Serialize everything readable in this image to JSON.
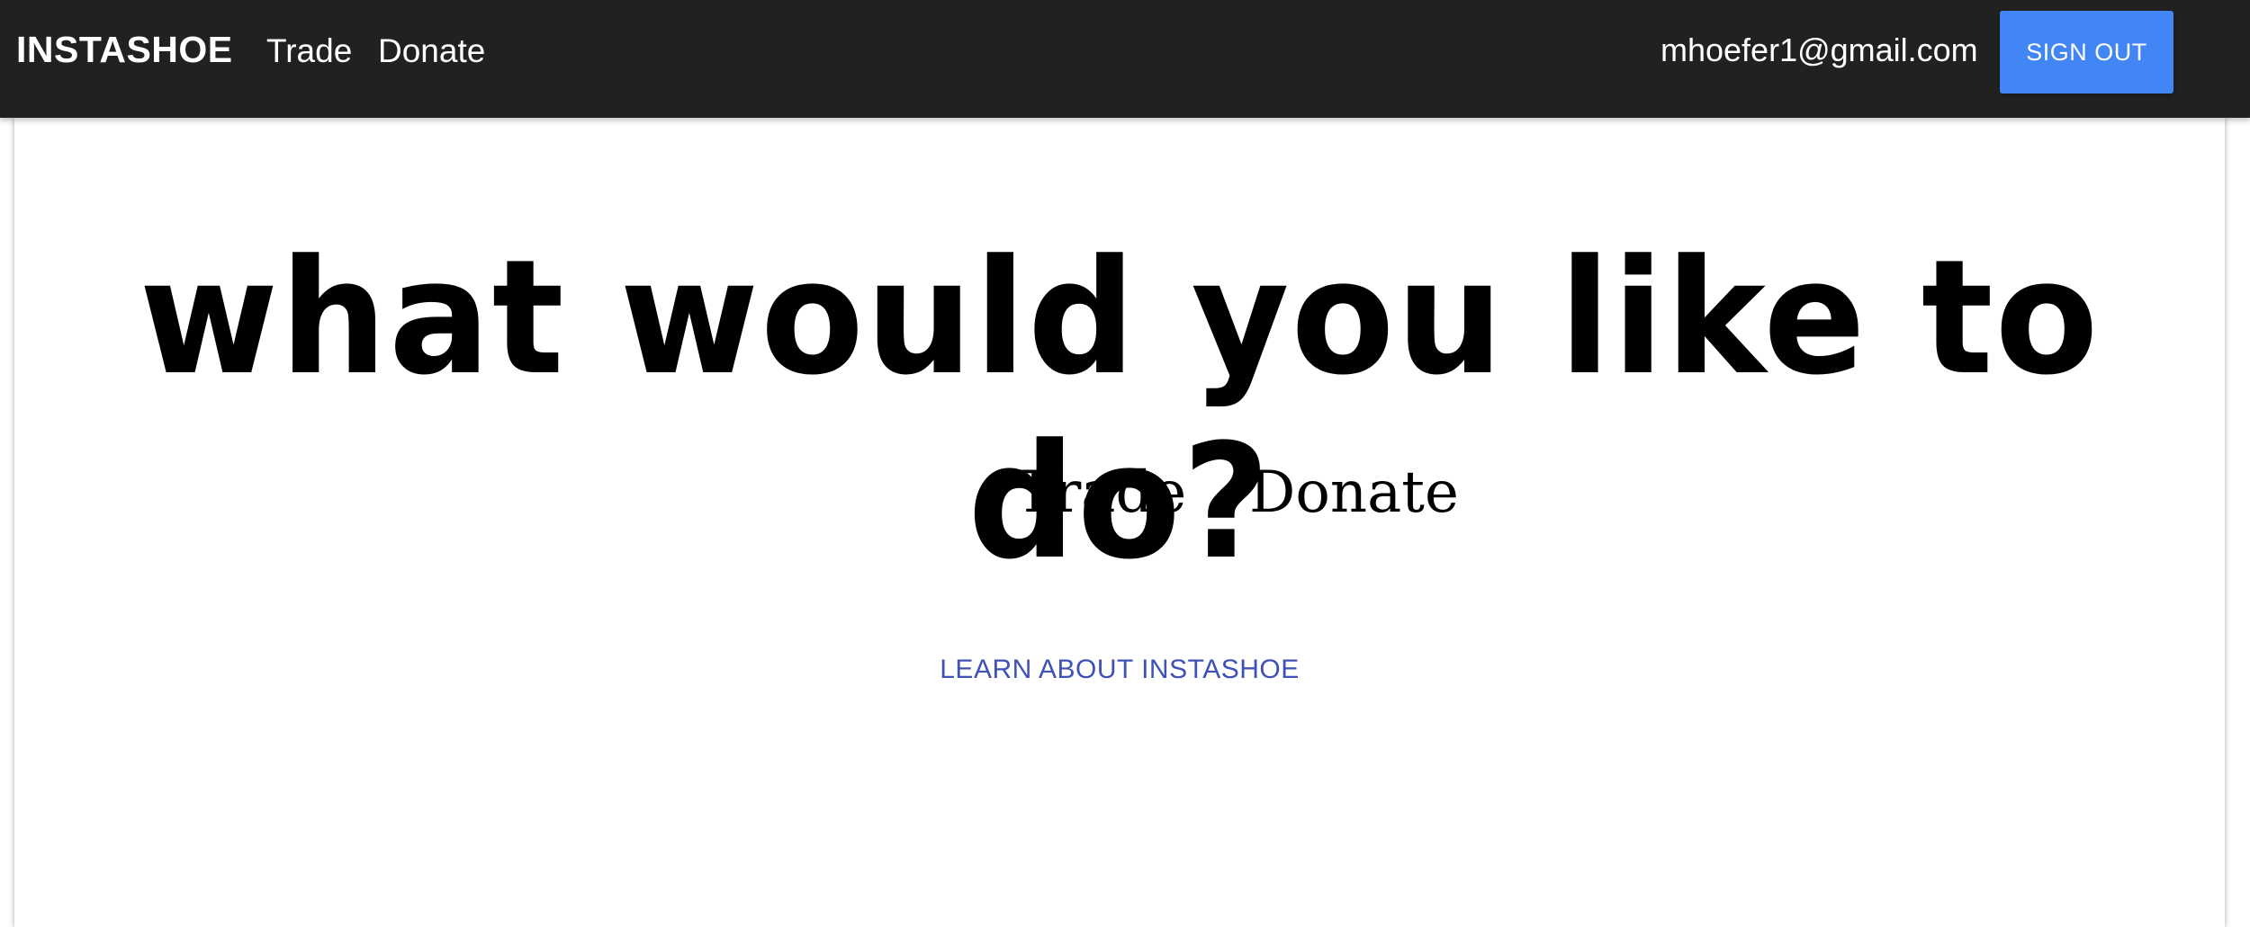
{
  "header": {
    "brand": "INSTASHOE",
    "nav_links": [
      {
        "label": "Trade"
      },
      {
        "label": "Donate"
      }
    ],
    "user_email": "mhoefer1@gmail.com",
    "sign_out_label": "SIGN OUT"
  },
  "main": {
    "headline": "what would you like to do?",
    "choices": [
      {
        "label": "Trade"
      },
      {
        "label": "Donate"
      }
    ],
    "learn_link": "LEARN ABOUT INSTASHOE"
  },
  "colors": {
    "navbar_bg": "#212121",
    "button_accent": "#4285f4",
    "link_color": "#3f51b5"
  }
}
